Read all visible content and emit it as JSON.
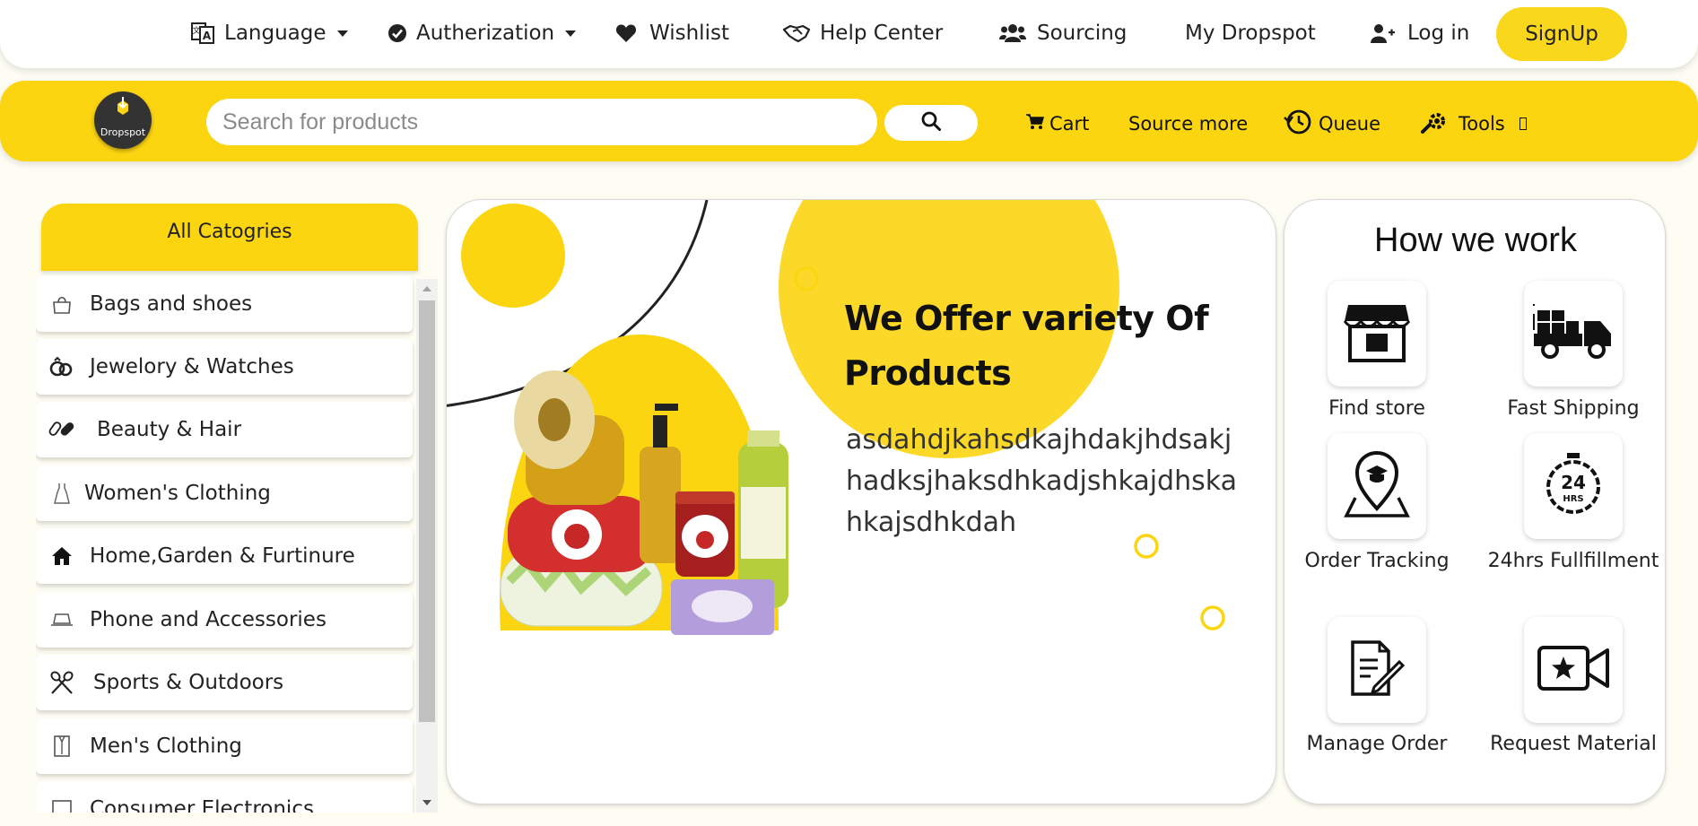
{
  "topbar": {
    "language": "Language",
    "authorization": "Autherization",
    "wishlist": "Wishlist",
    "help_center": "Help Center",
    "sourcing": "Sourcing",
    "my_dropspot": "My Dropspot",
    "login": "Log in",
    "signup": "SignUp"
  },
  "header": {
    "logo_text": "Dropspot",
    "search_placeholder": "Search for products",
    "cart": "Cart",
    "source_more": "Source more",
    "queue": "Queue",
    "tools": "Tools"
  },
  "categories": {
    "heading": "All Catogries",
    "items": [
      {
        "label": "Bags and shoes",
        "icon": "bag-icon"
      },
      {
        "label": "Jewelory & Watches",
        "icon": "rings-icon"
      },
      {
        "label": "Beauty & Hair",
        "icon": "pills-icon"
      },
      {
        "label": "Women's Clothing",
        "icon": "dress-icon"
      },
      {
        "label": "Home,Garden & Furtinure",
        "icon": "home-icon"
      },
      {
        "label": "Phone and Accessories",
        "icon": "phone-stand-icon"
      },
      {
        "label": "Sports & Outdoors",
        "icon": "rackets-icon"
      },
      {
        "label": "Men's Clothing",
        "icon": "shirt-icon"
      },
      {
        "label": "Consumer Electronics",
        "icon": "electronics-icon"
      }
    ]
  },
  "banner": {
    "title": "We Offer variety Of Products",
    "description": "asdahdjkahsdkajhdakjhdsakjhadksjhaksdhkadjshkajdhskahkajsdhkdah"
  },
  "how_we_work": {
    "title": "How we work",
    "items": [
      {
        "label": "Find store",
        "icon": "store-icon"
      },
      {
        "label": "Fast Shipping",
        "icon": "truck-icon"
      },
      {
        "label": "Order Tracking",
        "icon": "location-pin-icon"
      },
      {
        "label": "24hrs Fullfillment",
        "icon": "clock-24-icon"
      },
      {
        "label": "Manage Order",
        "icon": "document-edit-icon"
      },
      {
        "label": "Request Material",
        "icon": "video-star-icon"
      }
    ]
  },
  "colors": {
    "accent_yellow": "#fcd511",
    "background": "#fdfdf3",
    "dark": "#111111"
  }
}
